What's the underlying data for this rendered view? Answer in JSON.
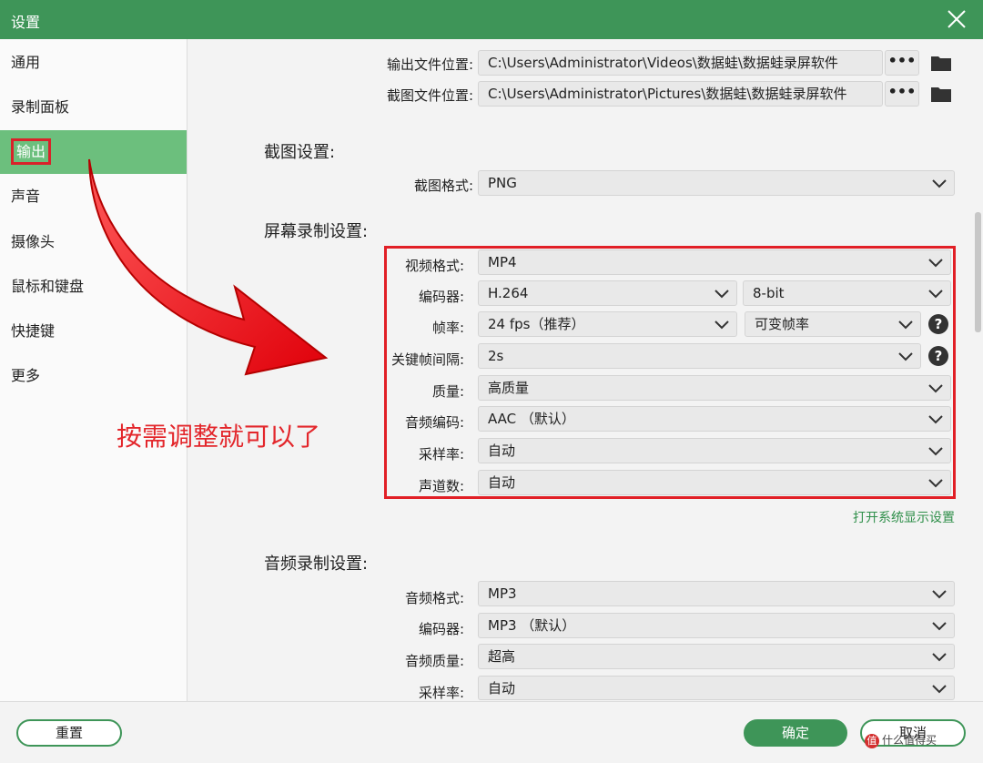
{
  "window": {
    "title": "设置"
  },
  "sidebar": {
    "items": [
      {
        "label": "通用"
      },
      {
        "label": "录制面板"
      },
      {
        "label": "输出"
      },
      {
        "label": "声音"
      },
      {
        "label": "摄像头"
      },
      {
        "label": "鼠标和键盘"
      },
      {
        "label": "快捷键"
      },
      {
        "label": "更多"
      }
    ],
    "active": "输出"
  },
  "output_paths": {
    "output_label": "输出文件位置:",
    "output_value": "C:\\Users\\Administrator\\Videos\\数据蛙\\数据蛙录屏软件",
    "screenshot_label": "截图文件位置:",
    "screenshot_value": "C:\\Users\\Administrator\\Pictures\\数据蛙\\数据蛙录屏软件",
    "browse_label": "•••"
  },
  "screenshot_settings": {
    "heading": "截图设置:",
    "format_label": "截图格式:",
    "format_value": "PNG"
  },
  "screen_recording": {
    "heading": "屏幕录制设置:",
    "video_format_label": "视频格式:",
    "video_format_value": "MP4",
    "encoder_label": "编码器:",
    "encoder_value": "H.264",
    "bit_depth_value": "8-bit",
    "framerate_label": "帧率:",
    "framerate_value": "24 fps（推荐）",
    "framerate_mode_value": "可变帧率",
    "keyframe_label": "关键帧间隔:",
    "keyframe_value": "2s",
    "quality_label": "质量:",
    "quality_value": "高质量",
    "audio_codec_label": "音频编码:",
    "audio_codec_value": "AAC （默认）",
    "sample_rate_label": "采样率:",
    "sample_rate_value": "自动",
    "channels_label": "声道数:",
    "channels_value": "自动",
    "display_settings_link": "打开系统显示设置"
  },
  "audio_recording": {
    "heading": "音频录制设置:",
    "format_label": "音频格式:",
    "format_value": "MP3",
    "encoder_label": "编码器:",
    "encoder_value": "MP3 （默认）",
    "quality_label": "音频质量:",
    "quality_value": "超高",
    "sample_rate_label": "采样率:",
    "sample_rate_value": "自动"
  },
  "annotation": {
    "text": "按需调整就可以了"
  },
  "footer": {
    "reset_label": "重置",
    "ok_label": "确定",
    "cancel_label": "取消"
  },
  "watermark": {
    "text": "什么值得买",
    "logo": "值"
  },
  "colors": {
    "accent": "#3e9558",
    "active_sidebar": "#6cbf7d",
    "annotation_red": "#e3262b"
  }
}
